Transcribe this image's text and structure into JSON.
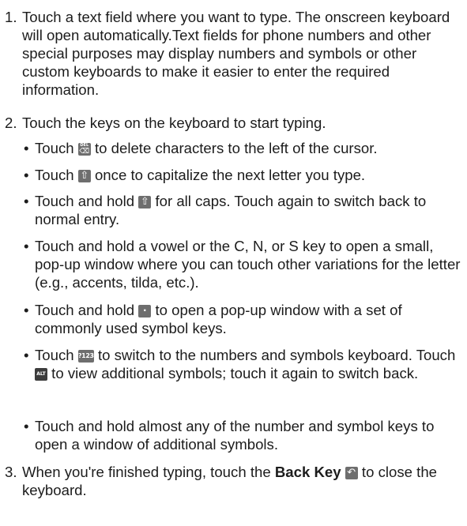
{
  "steps": {
    "s1": {
      "number": "1.",
      "text": "Touch a text field where you want to type. The onscreen keyboard will open automatically.Text fields for phone numbers and other special purposes may display numbers and symbols or other custom keyboards to make it easier to enter the required information."
    },
    "s2": {
      "number": "2.",
      "text": "Touch the keys on the keyboard to start typing."
    },
    "s3": {
      "number": "3.",
      "before": "When you're finished typing, touch the ",
      "bold": "Back Key",
      "after": " to close the keyboard."
    }
  },
  "bullets": {
    "marker": "•",
    "b1": {
      "before": "Touch ",
      "after": " to delete characters to the left of the cursor."
    },
    "b2": {
      "before": "Touch ",
      "after": " once to capitalize the next letter you type."
    },
    "b3": {
      "before": "Touch and hold ",
      "after": " for all caps. Touch again to switch back to normal entry."
    },
    "b4": {
      "text": "Touch and hold a vowel or the C, N, or S key to open a small, pop-up window where you can touch other variations for the letter (e.g., accents, tilda, etc.)."
    },
    "b5": {
      "before": "Touch and hold ",
      "after": " to open a pop-up window with a set of commonly used symbol keys."
    },
    "b6": {
      "before": "Touch ",
      "middle": " to switch to the numbers and symbols keyboard. Touch ",
      "after": " to view additional symbols; touch it again to switch back."
    },
    "b7": {
      "text": "Touch and hold almost any of the number and symbol keys to open a window of additional symbols."
    }
  },
  "keys": {
    "delete": {
      "label": "DEL",
      "glyph": "⌫",
      "icon": "delete-key-icon"
    },
    "shift": {
      "glyph": "⇧",
      "icon": "shift-key-icon"
    },
    "shift_hold": {
      "glyph": "⇧",
      "icon": "shift-key-icon"
    },
    "period": {
      "glyph": "·",
      "icon": "period-key-icon"
    },
    "sym": {
      "label": "?123",
      "icon": "numbers-symbols-key-icon"
    },
    "alt": {
      "label": "ALT",
      "icon": "alt-key-icon"
    },
    "back": {
      "glyph": "↶",
      "icon": "back-key-icon"
    }
  }
}
